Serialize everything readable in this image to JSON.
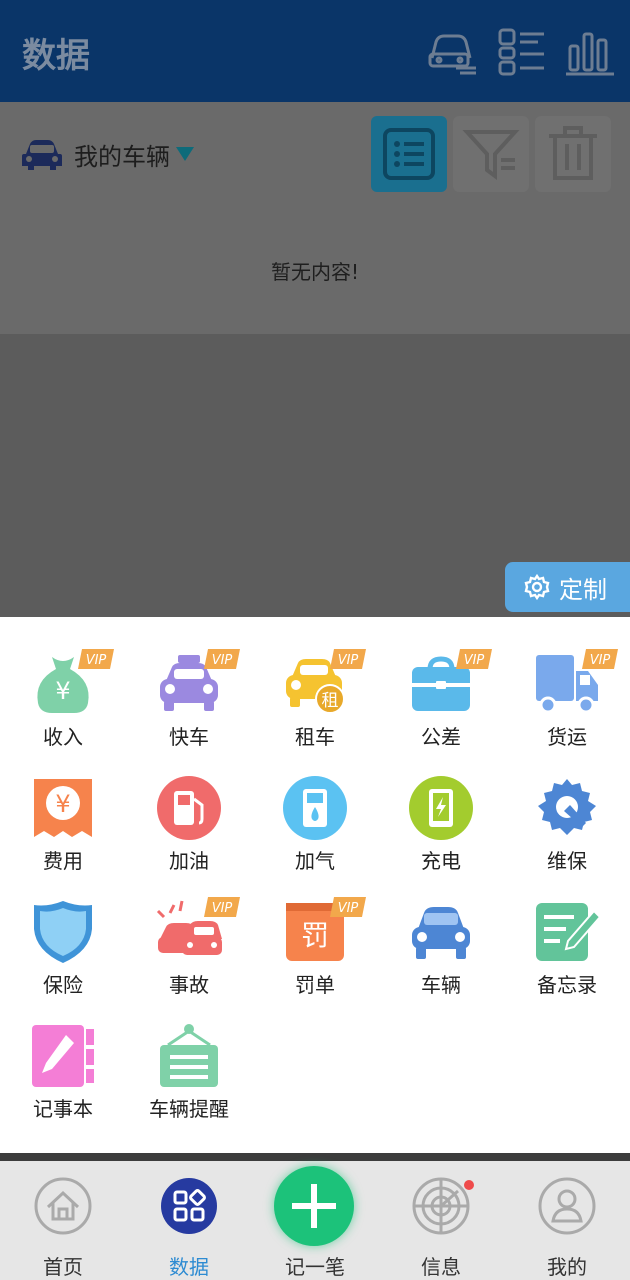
{
  "header": {
    "title": "数据",
    "icons": [
      "car-list-icon",
      "list-grid-icon",
      "bar-chart-icon"
    ]
  },
  "vehicle_selector": {
    "label": "我的车辆",
    "icon": "car-icon"
  },
  "toolbar": {
    "buttons": [
      "list-view-icon",
      "filter-icon",
      "delete-icon"
    ],
    "accent": "#1a6f8f"
  },
  "empty_state": {
    "text": "暂无内容!"
  },
  "customize": {
    "label": "定制",
    "icon": "gear-icon"
  },
  "categories": [
    {
      "label": "收入",
      "icon": "money-bag-icon",
      "vip": true,
      "vip_text": "VIP"
    },
    {
      "label": "快车",
      "icon": "taxi-icon",
      "vip": true,
      "vip_text": "VIP"
    },
    {
      "label": "租车",
      "icon": "rental-car-icon",
      "vip": true,
      "vip_text": "VIP"
    },
    {
      "label": "公差",
      "icon": "briefcase-icon",
      "vip": true,
      "vip_text": "VIP"
    },
    {
      "label": "货运",
      "icon": "truck-icon",
      "vip": true,
      "vip_text": "VIP"
    },
    {
      "label": "费用",
      "icon": "expense-icon",
      "vip": false
    },
    {
      "label": "加油",
      "icon": "fuel-pump-icon",
      "vip": false
    },
    {
      "label": "加气",
      "icon": "gas-icon",
      "vip": false
    },
    {
      "label": "充电",
      "icon": "charging-icon",
      "vip": false
    },
    {
      "label": "维保",
      "icon": "maintenance-icon",
      "vip": false
    },
    {
      "label": "保险",
      "icon": "shield-icon",
      "vip": false
    },
    {
      "label": "事故",
      "icon": "accident-icon",
      "vip": true,
      "vip_text": "VIP"
    },
    {
      "label": "罚单",
      "icon": "fine-icon",
      "vip": true,
      "vip_text": "VIP"
    },
    {
      "label": "车辆",
      "icon": "vehicle-icon",
      "vip": false
    },
    {
      "label": "备忘录",
      "icon": "memo-icon",
      "vip": false
    },
    {
      "label": "记事本",
      "icon": "notebook-icon",
      "vip": false
    },
    {
      "label": "车辆提醒",
      "icon": "reminder-icon",
      "vip": false
    }
  ],
  "bottom_nav": {
    "items": [
      {
        "label": "首页",
        "icon": "home-icon"
      },
      {
        "label": "数据",
        "icon": "data-icon",
        "active": true
      },
      {
        "label": "记一笔",
        "icon": "plus-icon"
      },
      {
        "label": "信息",
        "icon": "radar-icon",
        "badge": true
      },
      {
        "label": "我的",
        "icon": "user-icon"
      }
    ]
  },
  "colors": {
    "header_bg": "#0a3568",
    "active_nav": "#2d8bd2",
    "fab": "#1cc27a",
    "customize_bg": "#5aa7e0"
  }
}
